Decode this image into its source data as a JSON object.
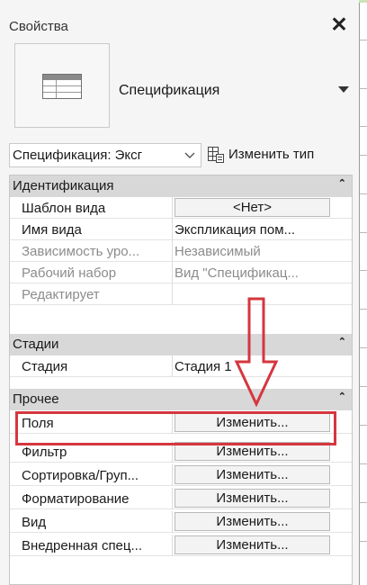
{
  "panel": {
    "title": "Свойства",
    "close_symbol": "✕"
  },
  "type_selector": {
    "icon": "schedule-table-icon",
    "name": "Спецификация"
  },
  "filter": {
    "selected": "Спецификация: Эксг",
    "edit_type_label": "Изменить тип",
    "edit_type_icon": "edit-type-icon"
  },
  "sections": [
    {
      "label": "Идентификация",
      "rows": [
        {
          "name": "Шаблон вида",
          "value": "<Нет>",
          "is_button": true,
          "dim": false
        },
        {
          "name": "Имя вида",
          "value": "Экспликация пом...",
          "is_button": false,
          "dim": false
        },
        {
          "name": "Зависимость уро...",
          "value": "Независимый",
          "is_button": false,
          "dim": true
        },
        {
          "name": "Рабочий набор",
          "value": "Вид \"Спецификац...",
          "is_button": false,
          "dim": true
        },
        {
          "name": "Редактирует",
          "value": "",
          "is_button": false,
          "dim": true
        }
      ]
    },
    {
      "label": "Стадии",
      "rows": [
        {
          "name": "Стадия",
          "value": "Стадия 1",
          "is_button": false,
          "dim": false
        }
      ]
    },
    {
      "label": "Прочее",
      "rows": [
        {
          "name": "Поля",
          "value": "Изменить...",
          "is_button": true,
          "dim": false
        },
        {
          "name": "Фильтр",
          "value": "Изменить...",
          "is_button": true,
          "dim": false
        },
        {
          "name": "Сортировка/Груп...",
          "value": "Изменить...",
          "is_button": true,
          "dim": false
        },
        {
          "name": "Форматирование",
          "value": "Изменить...",
          "is_button": true,
          "dim": false
        },
        {
          "name": "Вид",
          "value": "Изменить...",
          "is_button": true,
          "dim": false
        },
        {
          "name": "Внедренная спец...",
          "value": "Изменить...",
          "is_button": true,
          "dim": false
        }
      ]
    }
  ],
  "colors": {
    "highlight": "#d5363f",
    "section_bg": "#d8d8d8",
    "panel_bg": "#f5f5f5"
  }
}
